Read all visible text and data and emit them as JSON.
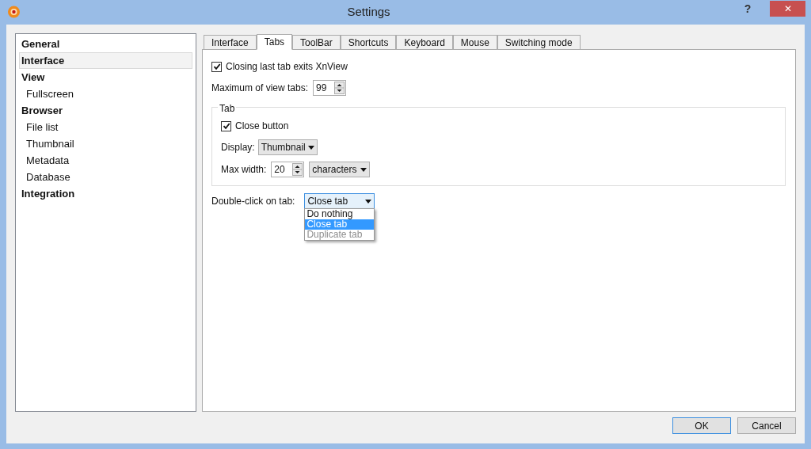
{
  "window": {
    "title": "Settings",
    "help": "?",
    "close": "✕"
  },
  "sidebar": {
    "items": [
      {
        "label": "General",
        "kind": "header",
        "selected": false
      },
      {
        "label": "Interface",
        "kind": "header",
        "selected": true
      },
      {
        "label": "View",
        "kind": "header",
        "selected": false
      },
      {
        "label": "Fullscreen",
        "kind": "child",
        "selected": false
      },
      {
        "label": "Browser",
        "kind": "header",
        "selected": false
      },
      {
        "label": "File list",
        "kind": "child",
        "selected": false
      },
      {
        "label": "Thumbnail",
        "kind": "child",
        "selected": false
      },
      {
        "label": "Metadata",
        "kind": "child",
        "selected": false
      },
      {
        "label": "Database",
        "kind": "child",
        "selected": false
      },
      {
        "label": "Integration",
        "kind": "header",
        "selected": false
      }
    ]
  },
  "tabs": [
    {
      "label": "Interface",
      "selected": false
    },
    {
      "label": "Tabs",
      "selected": true
    },
    {
      "label": "ToolBar",
      "selected": false
    },
    {
      "label": "Shortcuts",
      "selected": false
    },
    {
      "label": "Keyboard",
      "selected": false
    },
    {
      "label": "Mouse",
      "selected": false
    },
    {
      "label": "Switching mode",
      "selected": false
    }
  ],
  "closing_last_tab": {
    "label": "Closing last tab exits XnView",
    "checked": true
  },
  "max_view_tabs": {
    "label": "Maximum of view tabs:",
    "value": "99"
  },
  "tab_group": {
    "title": "Tab",
    "close_button": {
      "label": "Close button",
      "checked": true
    },
    "display": {
      "label": "Display:",
      "value": "Thumbnail"
    },
    "max_width": {
      "label": "Max width:",
      "value": "20",
      "unit": "characters"
    }
  },
  "double_click": {
    "label": "Double-click on tab:",
    "value": "Close tab",
    "expanded": true,
    "options": [
      {
        "label": "Do nothing",
        "selected": false,
        "disabled": false
      },
      {
        "label": "Close tab",
        "selected": true,
        "disabled": false
      },
      {
        "label": "Duplicate tab",
        "selected": false,
        "disabled": true
      }
    ]
  },
  "buttons": [
    {
      "label": "OK",
      "default": true
    },
    {
      "label": "Cancel",
      "default": false
    }
  ]
}
